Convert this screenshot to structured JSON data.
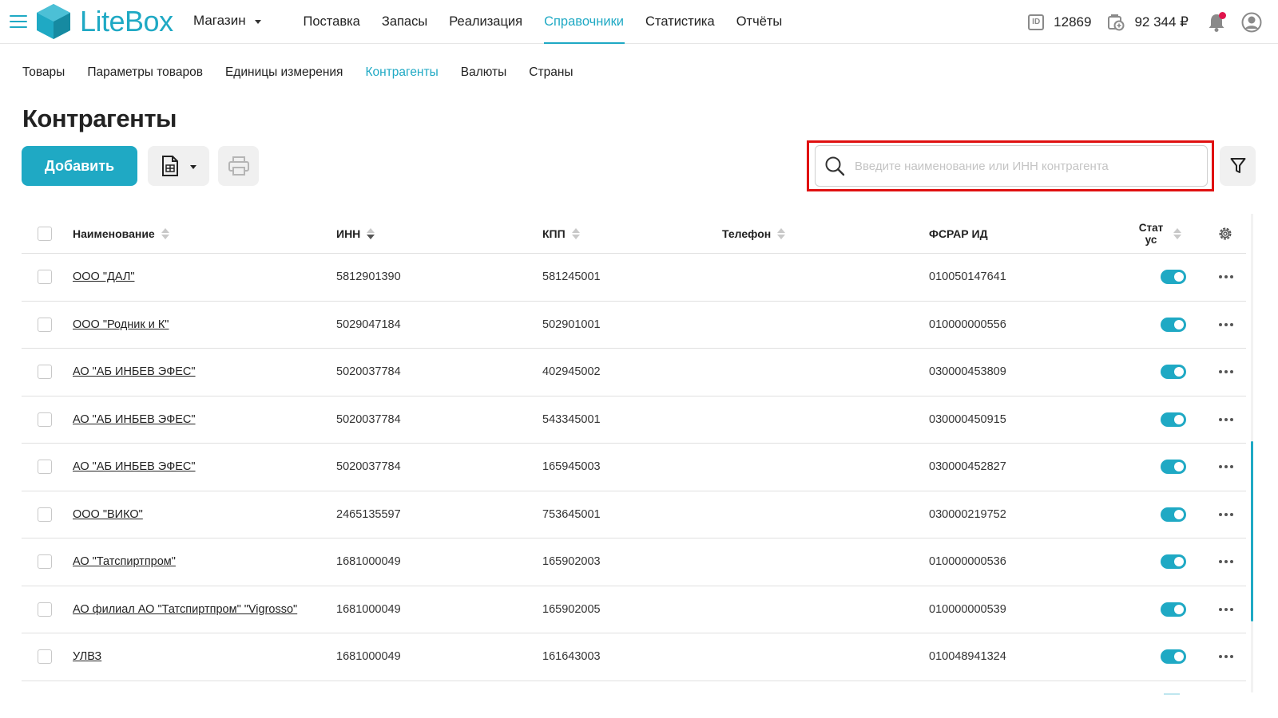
{
  "header": {
    "logo_text": "LiteBox",
    "store": "Магазин",
    "nav": [
      "Поставка",
      "Запасы",
      "Реализация",
      "Справочники",
      "Статистика",
      "Отчёты"
    ],
    "active_nav_index": 3,
    "id_label": "ID",
    "account_id": "12869",
    "balance": "92 344 ₽"
  },
  "subnav": {
    "items": [
      "Товары",
      "Параметры товаров",
      "Единицы измерения",
      "Контрагенты",
      "Валюты",
      "Страны"
    ],
    "active_index": 3
  },
  "page": {
    "title": "Контрагенты",
    "add_label": "Добавить",
    "search_placeholder": "Введите наименование или ИНН контрагента"
  },
  "table": {
    "headers": {
      "name": "Наименование",
      "inn": "ИНН",
      "kpp": "КПП",
      "phone": "Телефон",
      "fsrar": "ФСРАР ИД",
      "status_line1": "Стат",
      "status_line2": "ус"
    },
    "rows": [
      {
        "name": "ООО \"ДАЛ\"",
        "inn": "5812901390",
        "kpp": "581245001",
        "phone": "",
        "fsrar": "010050147641",
        "active": true
      },
      {
        "name": "ООО \"Родник и К\"",
        "inn": "5029047184",
        "kpp": "502901001",
        "phone": "",
        "fsrar": "010000000556",
        "active": true
      },
      {
        "name": "АО \"АБ ИНБЕВ ЭФЕС\"",
        "inn": "5020037784",
        "kpp": "402945002",
        "phone": "",
        "fsrar": "030000453809",
        "active": true
      },
      {
        "name": "АО \"АБ ИНБЕВ ЭФЕС\"",
        "inn": "5020037784",
        "kpp": "543345001",
        "phone": "",
        "fsrar": "030000450915",
        "active": true
      },
      {
        "name": "АО \"АБ ИНБЕВ ЭФЕС\"",
        "inn": "5020037784",
        "kpp": "165945003",
        "phone": "",
        "fsrar": "030000452827",
        "active": true
      },
      {
        "name": "ООО \"ВИКО\"",
        "inn": "2465135597",
        "kpp": "753645001",
        "phone": "",
        "fsrar": "030000219752",
        "active": true
      },
      {
        "name": "АО \"Татспиртпром\"",
        "inn": "1681000049",
        "kpp": "165902003",
        "phone": "",
        "fsrar": "010000000536",
        "active": true
      },
      {
        "name": "АО филиал АО \"Татспиртпром\" \"Vigrosso\"",
        "inn": "1681000049",
        "kpp": "165902005",
        "phone": "",
        "fsrar": "010000000539",
        "active": true
      },
      {
        "name": "УЛВЗ",
        "inn": "1681000049",
        "kpp": "161643003",
        "phone": "",
        "fsrar": "010048941324",
        "active": true
      }
    ]
  },
  "colors": {
    "accent": "#1fa9c4",
    "highlight": "#e01010",
    "notification": "#e0144c"
  }
}
